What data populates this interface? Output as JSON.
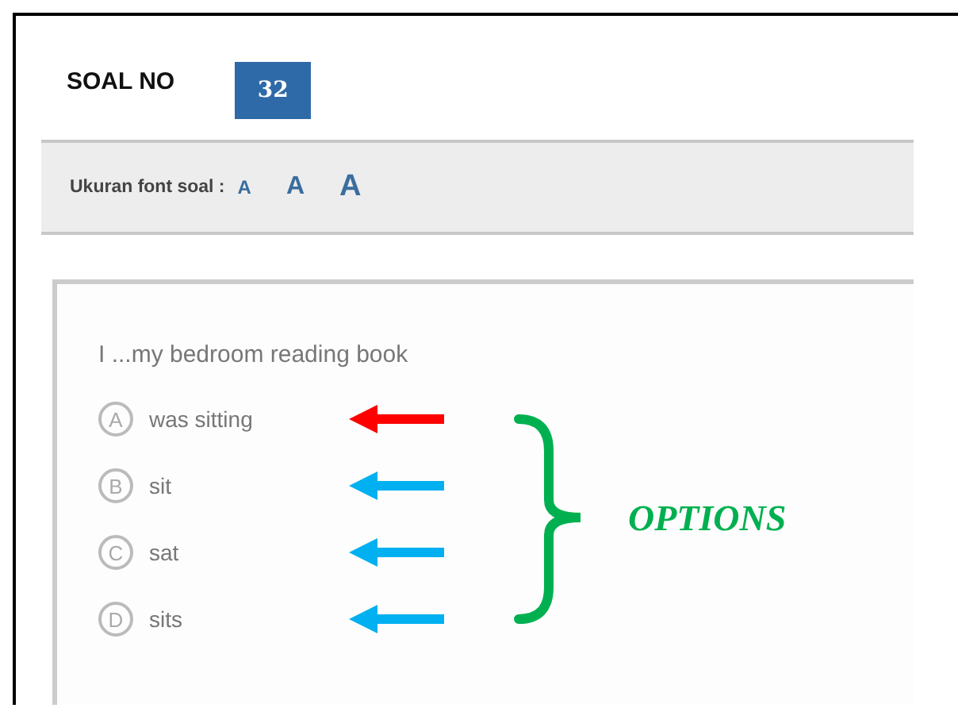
{
  "header": {
    "label": "SOAL NO",
    "number": "32"
  },
  "font_bar": {
    "label": "Ukuran font soal :",
    "sizes": [
      "A",
      "A",
      "A"
    ]
  },
  "question": {
    "text": "I ...my bedroom reading book",
    "options": [
      {
        "letter": "A",
        "text": "was sitting",
        "color": "#ff0000"
      },
      {
        "letter": "B",
        "text": "sit",
        "color": "#00b0f0"
      },
      {
        "letter": "C",
        "text": "sat",
        "color": "#00b0f0"
      },
      {
        "letter": "D",
        "text": "sits",
        "color": "#00b0f0"
      }
    ]
  },
  "annotation": {
    "label": "OPTIONS"
  }
}
